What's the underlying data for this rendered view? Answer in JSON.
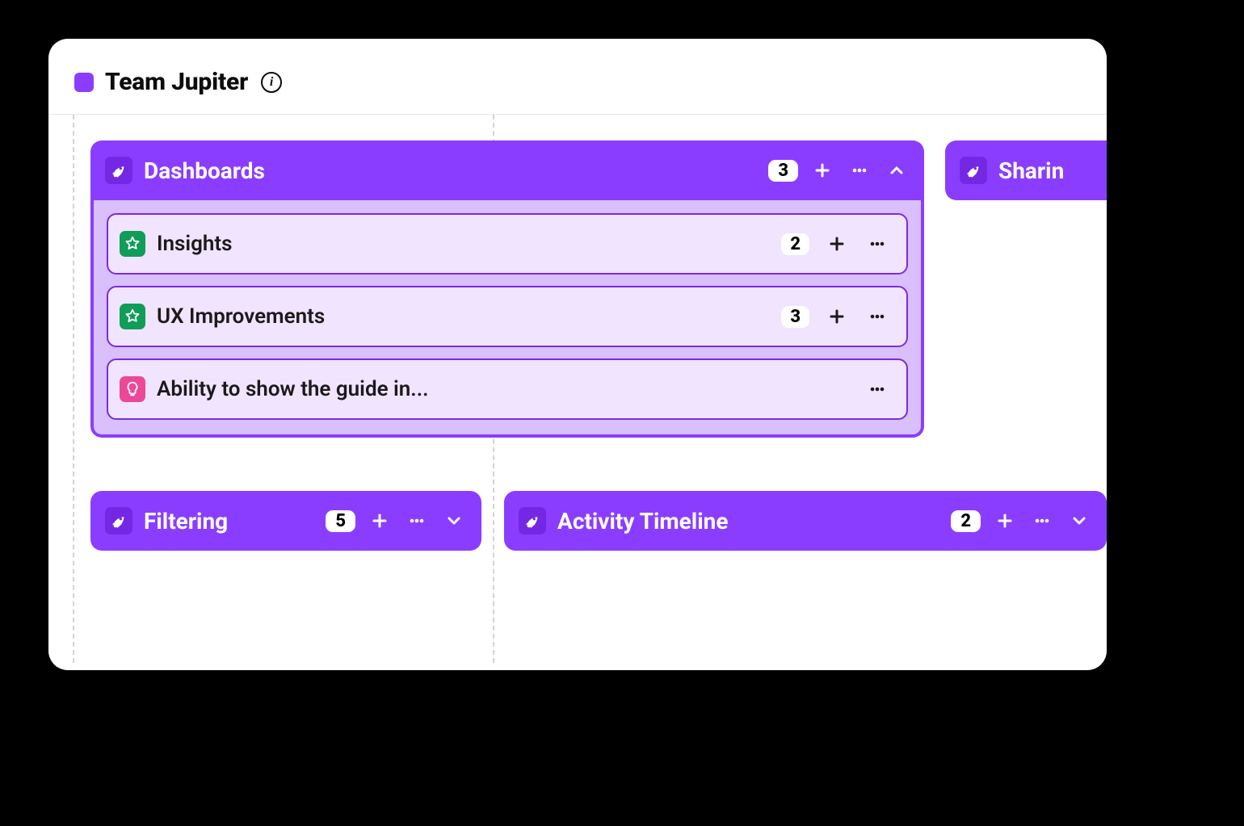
{
  "team": {
    "name": "Team Jupiter",
    "info_glyph": "i"
  },
  "epics": {
    "dashboards": {
      "title": "Dashboards",
      "count": "3",
      "stories": [
        {
          "icon": "star",
          "title": "Insights",
          "count": "2"
        },
        {
          "icon": "star",
          "title": "UX Improvements",
          "count": "3"
        },
        {
          "icon": "bulb",
          "title": "Ability to show the guide in..."
        }
      ]
    },
    "sharing": {
      "title": "Sharin"
    },
    "filtering": {
      "title": "Filtering",
      "count": "5"
    },
    "activity": {
      "title": "Activity Timeline",
      "count": "2"
    }
  }
}
